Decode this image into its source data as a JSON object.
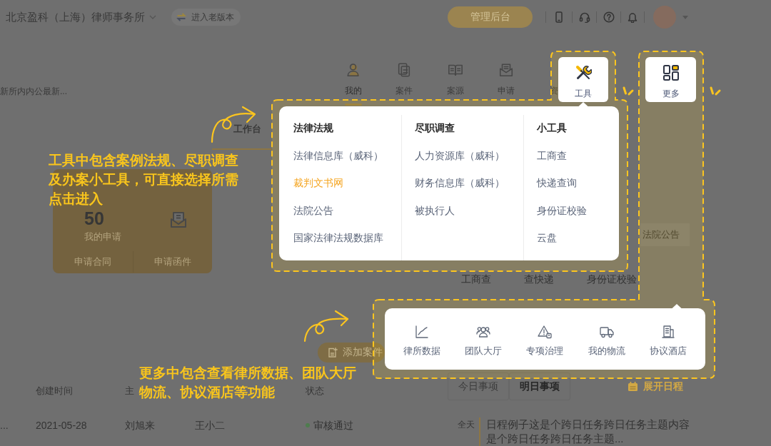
{
  "top_bar": {
    "firm_name": "北京盈科（上海）律师事务所",
    "old_version_button": "进入老版本",
    "admin_button": "管理后台"
  },
  "notice": "新所内内公最新...",
  "nav": {
    "items": [
      {
        "label": "我的",
        "selected": true
      },
      {
        "label": "案件",
        "selected": false
      },
      {
        "label": "案源",
        "selected": false
      },
      {
        "label": "申请",
        "selected": false
      }
    ],
    "cut_label_left": "资"
  },
  "tools_spotlight": {
    "label": "工具"
  },
  "more_spotlight": {
    "label": "更多"
  },
  "tools_menu": {
    "columns": [
      {
        "heading": "法律法规",
        "items": [
          {
            "label": "法律信息库（威科）",
            "selected": false
          },
          {
            "label": "裁判文书网",
            "selected": true
          },
          {
            "label": "法院公告",
            "selected": false
          },
          {
            "label": "国家法律法规数据库",
            "selected": false
          }
        ]
      },
      {
        "heading": "尽职调查",
        "items": [
          {
            "label": "人力资源库（威科）",
            "selected": false
          },
          {
            "label": "财务信息库（威科）",
            "selected": false
          },
          {
            "label": "被执行人",
            "selected": false
          }
        ]
      },
      {
        "heading": "小工具",
        "items": [
          {
            "label": "工商查",
            "selected": false
          },
          {
            "label": "快递查询",
            "selected": false
          },
          {
            "label": "身份证校验",
            "selected": false
          },
          {
            "label": "云盘",
            "selected": false
          }
        ]
      }
    ]
  },
  "workbench_tab": {
    "label": "工作台",
    "selected": true
  },
  "annotations": [
    {
      "lines": [
        "工具中包含案例法规、尽职调查",
        "及办案小工具，可直接选择所需",
        "点击进入"
      ]
    },
    {
      "lines": [
        "更多中包含查看律所数据、团队大厅",
        "物流、协议酒店等功能"
      ]
    }
  ],
  "application_card": {
    "count": "50",
    "title": "我的申请",
    "links": [
      "申请合同",
      "申请函件"
    ]
  },
  "court_notice_chip": "法院公告",
  "quick_tools": [
    "工商查",
    "查快递",
    "身份证校验"
  ],
  "more_menu": {
    "items": [
      {
        "label": "律所数据"
      },
      {
        "label": "团队大厅"
      },
      {
        "label": "专项治理"
      },
      {
        "label": "我的物流"
      },
      {
        "label": "协议酒店"
      }
    ]
  },
  "add_case_button": "添加案件",
  "table": {
    "columns": [
      null,
      "创建时间",
      "主",
      null,
      "状态"
    ],
    "rows": [
      {
        "cells": [
          "...",
          "2021-05-28",
          "刘旭来",
          "王小二",
          "审核通过"
        ],
        "color": "#4e7d4e"
      }
    ]
  },
  "schedule": {
    "tabs": [
      {
        "label": "今日事项",
        "selected": false
      },
      {
        "label": "明日事项",
        "selected": true
      }
    ],
    "expand_button": "展开日程",
    "events": [
      {
        "time": "全天",
        "title": "日程例子这是个跨日任务跨日任务主题内容是个跨日任务跨日任务主题..."
      }
    ]
  }
}
